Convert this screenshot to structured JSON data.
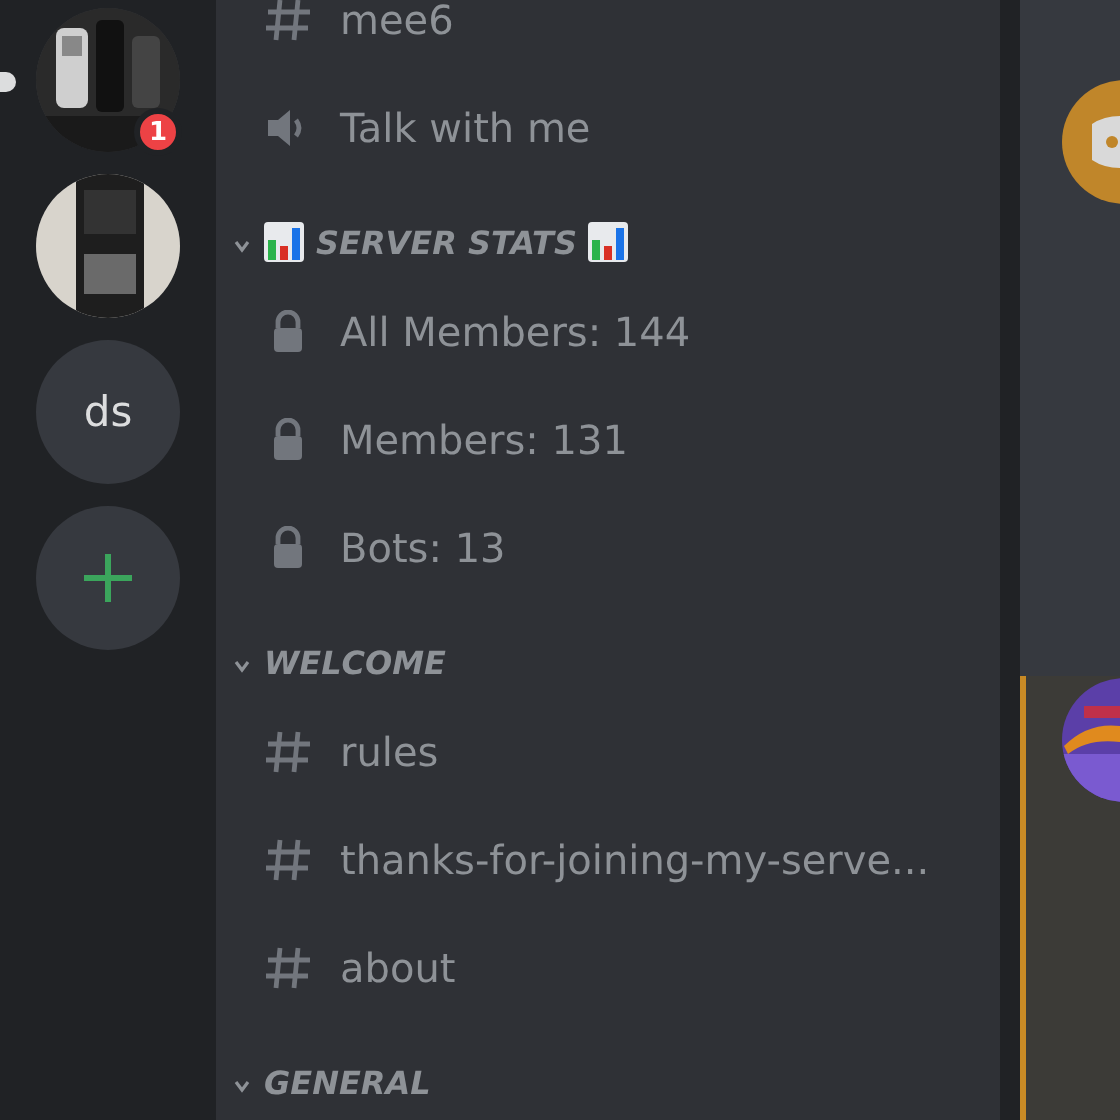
{
  "servers": [
    {
      "kind": "picture",
      "unread": true,
      "badge": "1"
    },
    {
      "kind": "picture"
    },
    {
      "kind": "text",
      "label": "ds"
    },
    {
      "kind": "add"
    }
  ],
  "channel_groups": [
    {
      "items": [
        {
          "kind": "text",
          "name": "mee6"
        },
        {
          "kind": "voice",
          "name": "Talk with me"
        }
      ]
    },
    {
      "category": {
        "name": "SERVER STATS",
        "chart_emoji": true,
        "expanded": true
      },
      "items": [
        {
          "kind": "locked",
          "name": "All Members: 144"
        },
        {
          "kind": "locked",
          "name": "Members: 131"
        },
        {
          "kind": "locked",
          "name": "Bots: 13"
        }
      ]
    },
    {
      "category": {
        "name": "WELCOME",
        "chart_emoji": false,
        "expanded": true
      },
      "items": [
        {
          "kind": "text",
          "name": "rules"
        },
        {
          "kind": "text",
          "name": "thanks-for-joining-my-serve..."
        },
        {
          "kind": "text",
          "name": "about"
        }
      ]
    },
    {
      "category": {
        "name": "GENERAL",
        "chart_emoji": false,
        "expanded": true
      }
    }
  ],
  "messages": [
    {
      "kind": "avatar",
      "highlighted": false
    },
    {
      "kind": "picture",
      "highlighted": true
    }
  ]
}
